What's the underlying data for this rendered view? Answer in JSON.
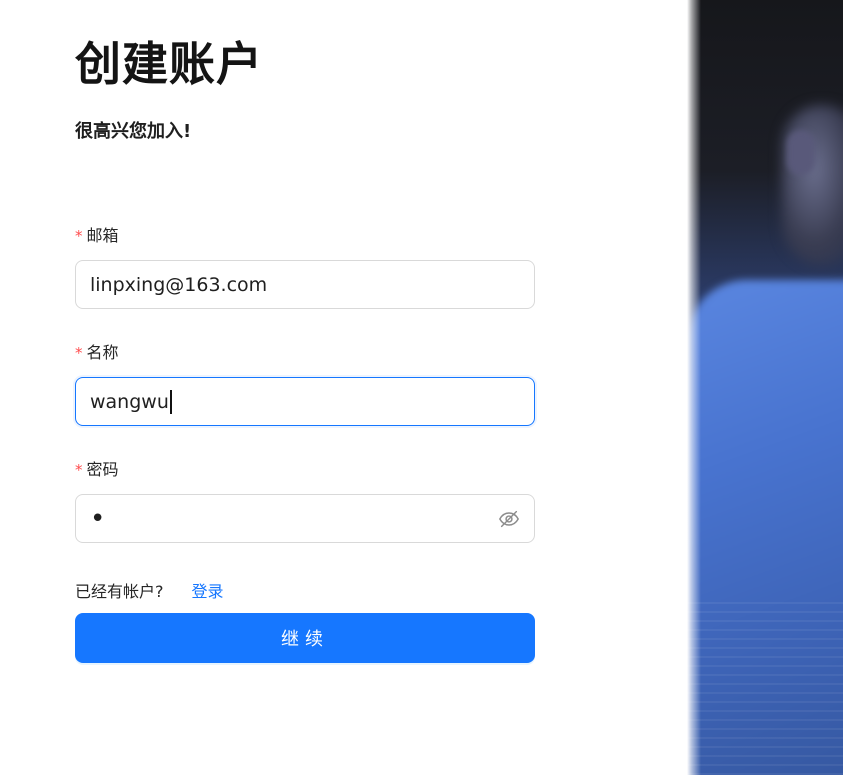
{
  "header": {
    "title": "创建账户",
    "subtitle": "很高兴您加入!"
  },
  "form": {
    "required_mark": "*",
    "email": {
      "label": "邮箱",
      "value": "linpxing@163.com"
    },
    "name": {
      "label": "名称",
      "value": "wangwu"
    },
    "password": {
      "label": "密码",
      "masked_value": "•",
      "toggle_icon": "eye-off-icon"
    },
    "login_prompt": "已经有帐户?",
    "login_link": "登录",
    "submit_label": "继续"
  },
  "colors": {
    "primary": "#1677ff",
    "required": "#ff4d4f",
    "border": "#d9d9d9"
  }
}
